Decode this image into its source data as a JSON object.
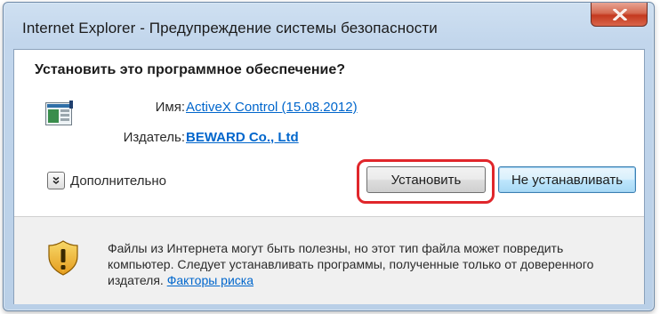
{
  "window": {
    "title": "Internet Explorer - Предупреждение системы безопасности"
  },
  "dialog": {
    "question": "Установить это программное обеспечение?",
    "name_label": "Имя:",
    "name_value": "ActiveX Control (15.08.2012)",
    "publisher_label": "Издатель:",
    "publisher_value": "BEWARD Co., Ltd",
    "more_label": "Дополнительно",
    "install_button": "Установить",
    "dont_install_button": "Не устанавливать"
  },
  "footer": {
    "warning_text": "Файлы из Интернета могут быть полезны, но этот тип файла может повредить компьютер. Следует устанавливать программы, полученные только от доверенного издателя. ",
    "risk_link": "Факторы риска"
  },
  "icons": {
    "close": "close-icon",
    "app": "activex-app-icon",
    "chevron": "chevron-down-icon",
    "shield": "security-shield-icon"
  },
  "colors": {
    "link": "#0066cc",
    "highlight_ring": "#e0262b",
    "close_button": "#c4391f"
  }
}
